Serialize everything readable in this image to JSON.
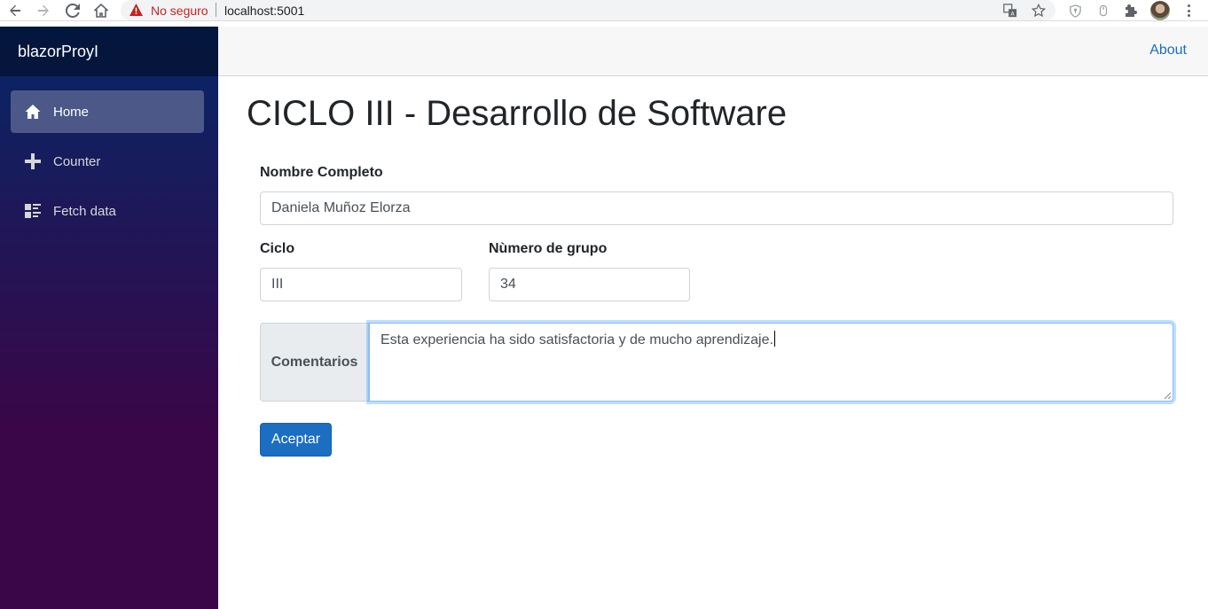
{
  "browser": {
    "security_label": "No seguro",
    "url": "localhost:5001"
  },
  "sidebar": {
    "brand": "blazorProyI",
    "items": [
      {
        "label": "Home",
        "icon": "home-icon",
        "active": true
      },
      {
        "label": "Counter",
        "icon": "plus-icon",
        "active": false
      },
      {
        "label": "Fetch data",
        "icon": "list-rich-icon",
        "active": false
      }
    ]
  },
  "top_row": {
    "about_label": "About"
  },
  "main": {
    "title": "CICLO III - Desarrollo de Software",
    "full_name": {
      "label": "Nombre Completo",
      "value": "Daniela Muñoz Elorza"
    },
    "cycle": {
      "label": "Ciclo",
      "value": "III"
    },
    "group_number": {
      "label": "Nùmero de grupo",
      "value": "34"
    },
    "comments": {
      "label": "Comentarios",
      "value": "Esta experiencia ha sido satisfactoria y de mucho aprendizaje."
    },
    "submit_label": "Aceptar"
  },
  "colors": {
    "primary": "#1b6ec2",
    "sidebar_top": "#052767",
    "sidebar_bottom": "#3a0647",
    "warning": "#c5221f"
  }
}
